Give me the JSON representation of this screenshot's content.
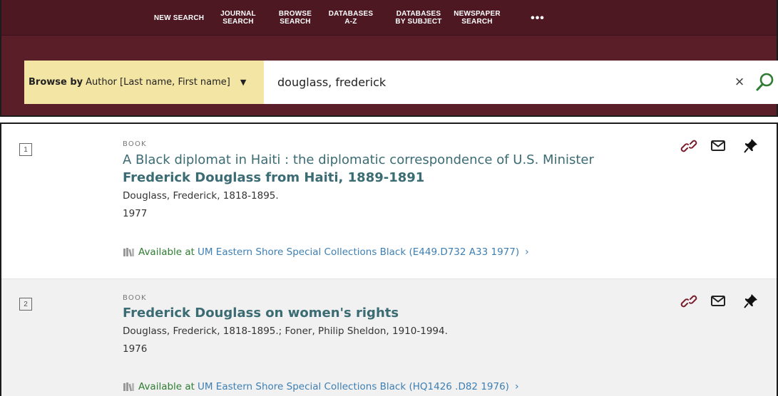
{
  "nav": {
    "items": [
      {
        "line1": "NEW SEARCH",
        "line2": ""
      },
      {
        "line1": "JOURNAL",
        "line2": "SEARCH"
      },
      {
        "line1": "BROWSE",
        "line2": "SEARCH"
      },
      {
        "line1": "DATABASES",
        "line2": "A-Z"
      },
      {
        "line1": "DATABASES",
        "line2": "BY SUBJECT"
      },
      {
        "line1": "NEWSPAPER",
        "line2": "SEARCH"
      }
    ],
    "more_label": "•••"
  },
  "search": {
    "browse_by_label": "Browse by",
    "browse_by_value": "Author [Last name, First name]",
    "query": "douglass, frederick",
    "clear_label": "×"
  },
  "results": [
    {
      "index": "1",
      "type": "BOOK",
      "title_plain": "A Black diplomat in Haiti : the diplomatic correspondence of U.S. Minister ",
      "title_bold": "Frederick Douglass from Haiti, 1889-1891",
      "author": "Douglass, Frederick, 1818-1895.",
      "year": "1977",
      "availability": "Available at",
      "location": "UM Eastern Shore  Special Collections Black (E449.D732 A33 1977)",
      "chevron": "›"
    },
    {
      "index": "2",
      "type": "BOOK",
      "title_plain": "",
      "title_bold": "Frederick Douglass on women's rights",
      "author": "Douglass, Frederick, 1818-1895.; Foner, Philip Sheldon, 1910-1994.",
      "year": "1976",
      "availability": "Available at",
      "location": "UM Eastern Shore  Special Collections Black (HQ1426 .D82 1976)",
      "chevron": "›"
    }
  ],
  "colors": {
    "header": "#5a1e29",
    "scope": "#f3e5a4",
    "title": "#3b6b73",
    "available": "#2e7d32",
    "link": "#3e7fb3",
    "search_icon": "#2e7d32",
    "row_alt": "#f1f1f1"
  },
  "icons": [
    "link-icon",
    "email-icon",
    "pin-icon",
    "search-icon",
    "close-icon",
    "book-icon",
    "chevron-down-icon",
    "chevron-right-icon"
  ]
}
